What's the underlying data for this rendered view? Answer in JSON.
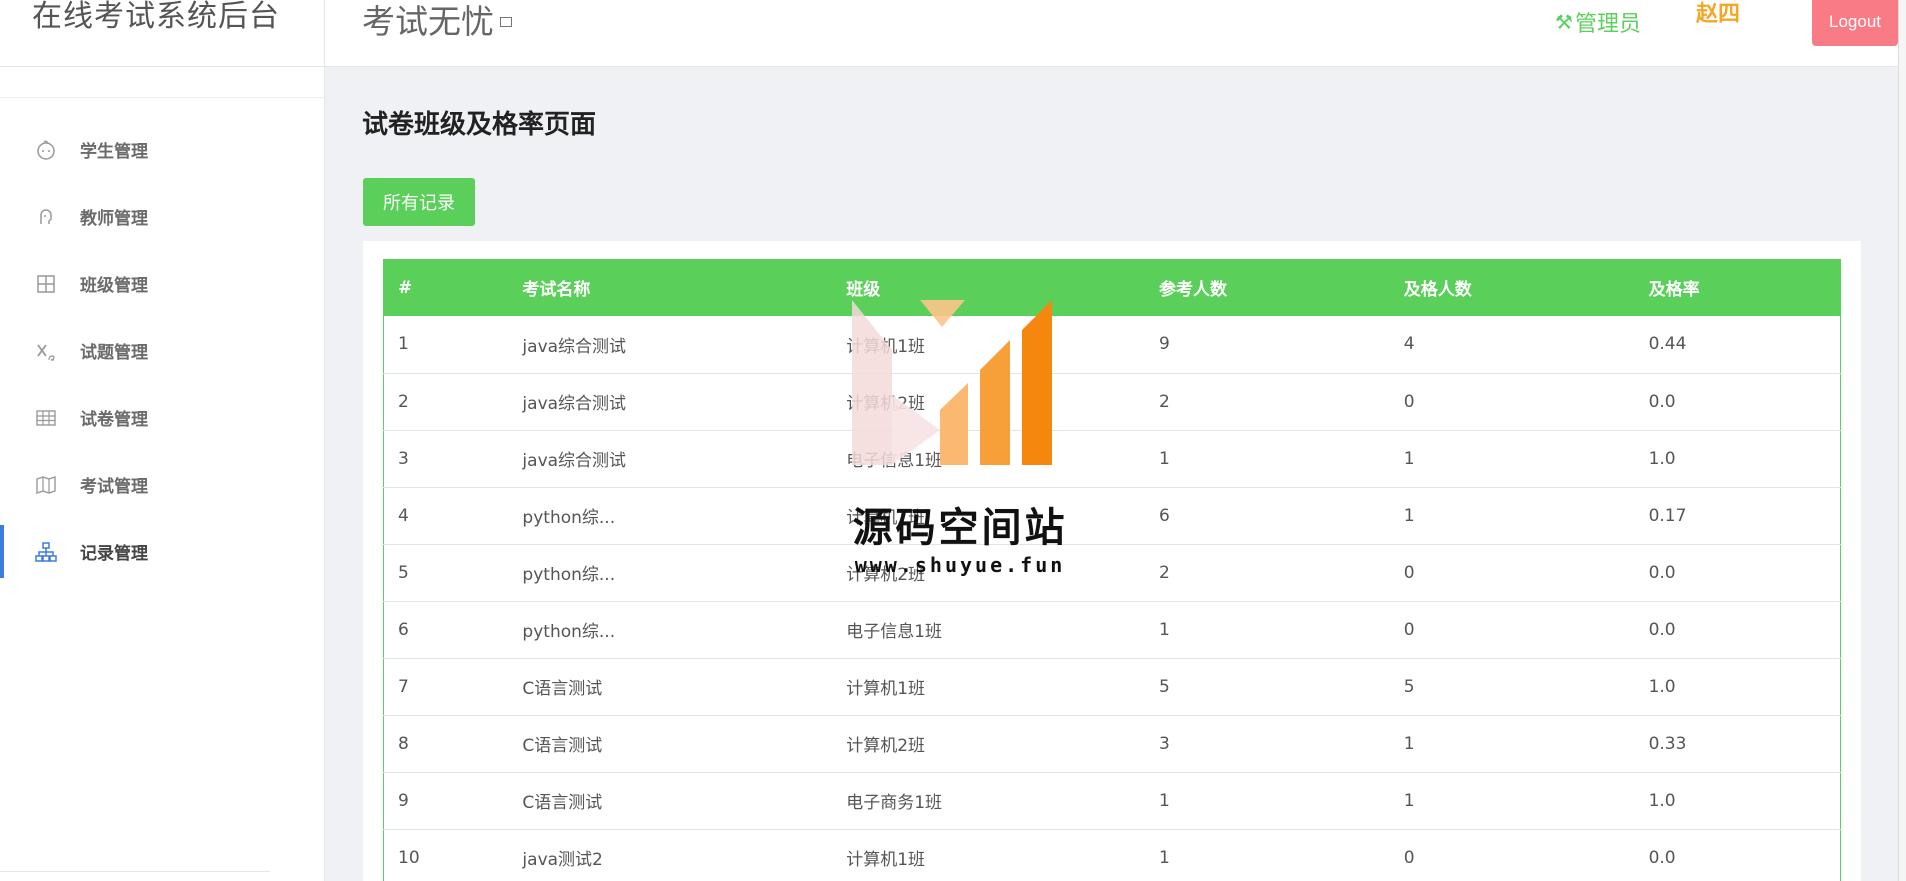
{
  "sidebar": {
    "brand": "在线考试系统后台",
    "items": [
      {
        "label": "学生管理",
        "icon": "baby-face-icon",
        "active": false
      },
      {
        "label": "教师管理",
        "icon": "user-head-icon",
        "active": false
      },
      {
        "label": "班级管理",
        "icon": "layout-grid-icon",
        "active": false
      },
      {
        "label": "试题管理",
        "icon": "subscript-x-icon",
        "active": false
      },
      {
        "label": "试卷管理",
        "icon": "table-grid-icon",
        "active": false
      },
      {
        "label": "考试管理",
        "icon": "map-icon",
        "active": false
      },
      {
        "label": "记录管理",
        "icon": "sitemap-icon",
        "active": true
      }
    ]
  },
  "header": {
    "app_title": "考试无忧",
    "role_link": "管理员",
    "user_name": "赵四",
    "logout_label": "Logout"
  },
  "main": {
    "page_title": "试卷班级及格率页面",
    "records_button": "所有记录",
    "table": {
      "columns": [
        "#",
        "考试名称",
        "班级",
        "参考人数",
        "及格人数",
        "及格率"
      ],
      "rows": [
        [
          "1",
          "java综合测试",
          "计算机1班",
          "9",
          "4",
          "0.44"
        ],
        [
          "2",
          "java综合测试",
          "计算机2班",
          "2",
          "0",
          "0.0"
        ],
        [
          "3",
          "java综合测试",
          "电子信息1班",
          "1",
          "1",
          "1.0"
        ],
        [
          "4",
          "python综...",
          "计算机1班",
          "6",
          "1",
          "0.17"
        ],
        [
          "5",
          "python综...",
          "计算机2班",
          "2",
          "0",
          "0.0"
        ],
        [
          "6",
          "python综...",
          "电子信息1班",
          "1",
          "0",
          "0.0"
        ],
        [
          "7",
          "C语言测试",
          "计算机1班",
          "5",
          "5",
          "1.0"
        ],
        [
          "8",
          "C语言测试",
          "计算机2班",
          "3",
          "1",
          "0.33"
        ],
        [
          "9",
          "C语言测试",
          "电子商务1班",
          "1",
          "1",
          "1.0"
        ],
        [
          "10",
          "java测试2",
          "计算机1班",
          "1",
          "0",
          "0.0"
        ]
      ]
    }
  },
  "watermark": {
    "text": "源码空间站",
    "url": "www.shuyue.fun"
  },
  "colors": {
    "accent_green": "#5acf5a",
    "logout_pink": "#f87b86",
    "user_orange": "#f5a623",
    "active_blue": "#3b7ddd"
  }
}
